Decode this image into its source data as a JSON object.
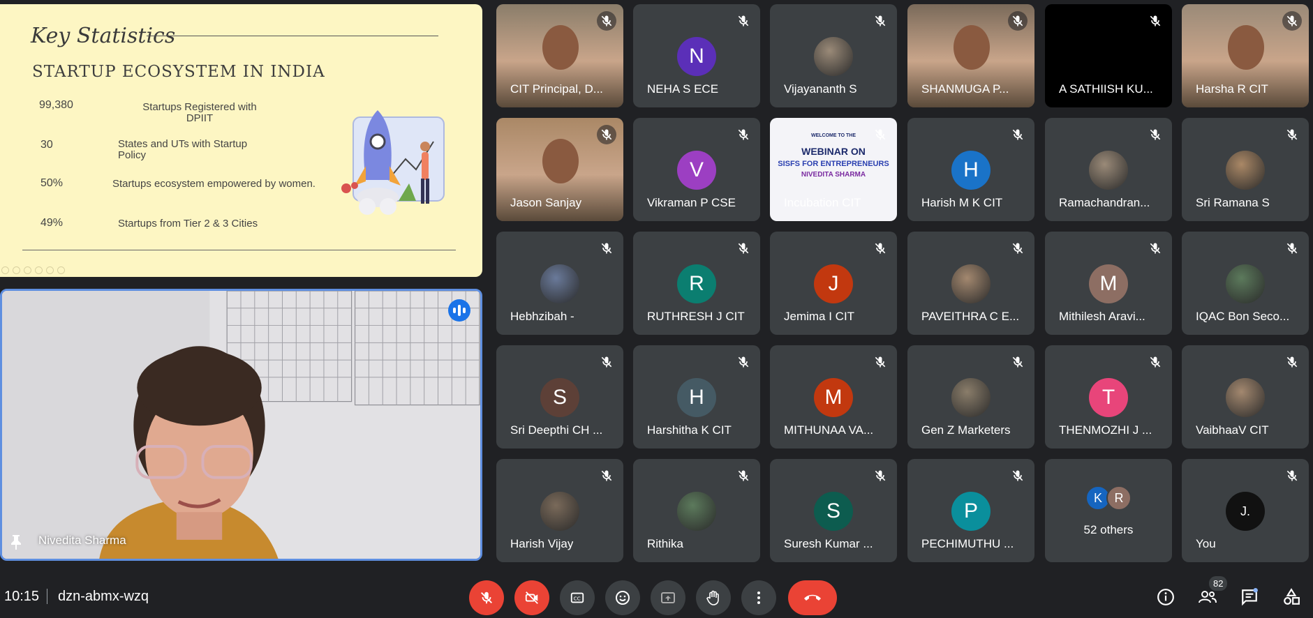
{
  "slide": {
    "script_title": "Key Statistics",
    "heading": "STARTUP ECOSYSTEM IN INDIA",
    "stats": [
      {
        "value": "99,380",
        "desc": "Startups Registered with DPIIT"
      },
      {
        "value": "30",
        "desc": "States and UTs with Startup Policy"
      },
      {
        "value": "50%",
        "desc": "Startups ecosystem empowered by women."
      },
      {
        "value": "49%",
        "desc": "Startups from Tier 2 & 3 Cities"
      }
    ]
  },
  "speaker": {
    "name": "Nivedita Sharma"
  },
  "participants": [
    {
      "name": "CIT Principal, D...",
      "type": "photo"
    },
    {
      "name": "NEHA S ECE",
      "initial": "N",
      "color": "#5b2fb8"
    },
    {
      "name": "Vijayananth S",
      "type": "avatar-photo"
    },
    {
      "name": "SHANMUGA P...",
      "type": "photo"
    },
    {
      "name": "A SATHIISH KU...",
      "type": "black"
    },
    {
      "name": "Harsha R CIT",
      "type": "photo"
    },
    {
      "name": "Jason Sanjay",
      "type": "photo"
    },
    {
      "name": "Vikraman P CSE",
      "initial": "V",
      "color": "#9c3fc2"
    },
    {
      "name": "Incubation CIT",
      "type": "poster"
    },
    {
      "name": "Harish M K CIT",
      "initial": "H",
      "color": "#1a73c8"
    },
    {
      "name": "Ramachandran...",
      "type": "avatar-photo"
    },
    {
      "name": "Sri Ramana S",
      "type": "avatar-photo"
    },
    {
      "name": "Hebhzibah -",
      "type": "avatar-photo"
    },
    {
      "name": "RUTHRESH J CIT",
      "initial": "R",
      "color": "#0b7e70"
    },
    {
      "name": "Jemima I CIT",
      "initial": "J",
      "color": "#c2380f"
    },
    {
      "name": "PAVEITHRA C E...",
      "type": "avatar-photo"
    },
    {
      "name": "Mithilesh Aravi...",
      "initial": "M",
      "color": "#8d6e63"
    },
    {
      "name": "IQAC Bon Seco...",
      "type": "avatar-photo"
    },
    {
      "name": "Sri Deepthi CH ...",
      "initial": "S",
      "color": "#5d4037"
    },
    {
      "name": "Harshitha K CIT",
      "initial": "H",
      "color": "#455a64"
    },
    {
      "name": "MITHUNAA VA...",
      "initial": "M",
      "color": "#c2380f"
    },
    {
      "name": "Gen Z Marketers",
      "type": "avatar-photo"
    },
    {
      "name": "THENMOZHI J ...",
      "initial": "T",
      "color": "#e8457a"
    },
    {
      "name": "VaibhaaV CIT",
      "type": "avatar-photo"
    },
    {
      "name": "Harish Vijay",
      "type": "avatar-photo"
    },
    {
      "name": "Rithika",
      "type": "avatar-photo"
    },
    {
      "name": "Suresh Kumar ...",
      "initial": "S",
      "color": "#0d5c4f"
    },
    {
      "name": "PECHIMUTHU ...",
      "initial": "P",
      "color": "#0a8f9c"
    },
    {
      "name": "52 others",
      "type": "others",
      "initials": [
        "K",
        "R"
      ]
    },
    {
      "name": "You",
      "type": "you",
      "initial": "J."
    }
  ],
  "poster": {
    "line1": "WELCOME TO THE",
    "line2": "WEBINAR ON",
    "line3": "SISFS FOR ENTREPRENEURS",
    "line4": "NIVEDITA SHARMA"
  },
  "bottombar": {
    "time": "10:15",
    "meeting_code": "dzn-abmx-wzq",
    "participant_count": "82"
  }
}
